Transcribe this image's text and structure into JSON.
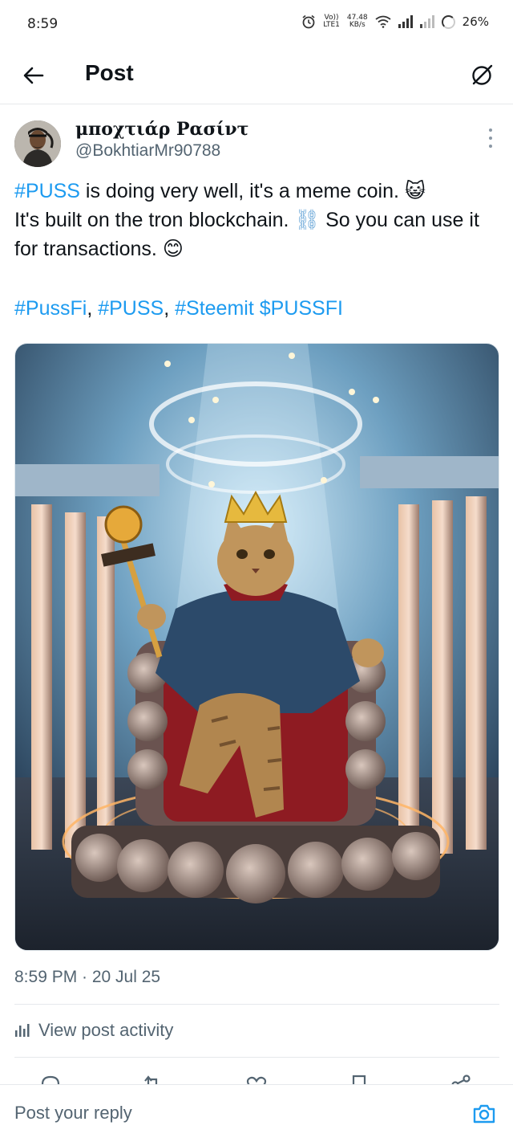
{
  "status_bar": {
    "time": "8:59",
    "volte_top": "Vo))",
    "volte_bottom": "LTE1",
    "speed_top": "47.48",
    "speed_bottom": "KB/s",
    "battery": "26%"
  },
  "header": {
    "title": "Post",
    "back_icon": "arrow-left-icon",
    "grok_icon": "grok-icon"
  },
  "post": {
    "author_name": "μποχτιάρ Ρασίντ",
    "author_handle": "@BokhtiarMr90788",
    "text_tag1": "#PUSS",
    "text_line1": " is doing very well, it's a meme coin. ",
    "emoji_cat": "😺",
    "text_line2": "It's built on the tron blockchain. ",
    "emoji_chain": "⛓",
    "text_line3": " So you can use it for transactions. ",
    "emoji_smile": "😊",
    "tags": {
      "t1": "#PussFi",
      "sep1": ", ",
      "t2": "#PUSS",
      "sep2": ", ",
      "t3": "#Steemit",
      "sep3": " ",
      "t4": "$PUSSFI"
    },
    "image_alt": "Cat wearing a crown seated on a crypto-coin throne",
    "timestamp": "8:59 PM · 20 Jul 25",
    "activity_label": "View post activity"
  },
  "actions": [
    "reply-icon",
    "repost-icon",
    "like-icon",
    "bookmark-icon",
    "share-icon"
  ],
  "reply": {
    "placeholder": "Post your reply"
  },
  "colors": {
    "accent": "#1d9bf0",
    "text": "#0f1419",
    "muted": "#536471"
  }
}
